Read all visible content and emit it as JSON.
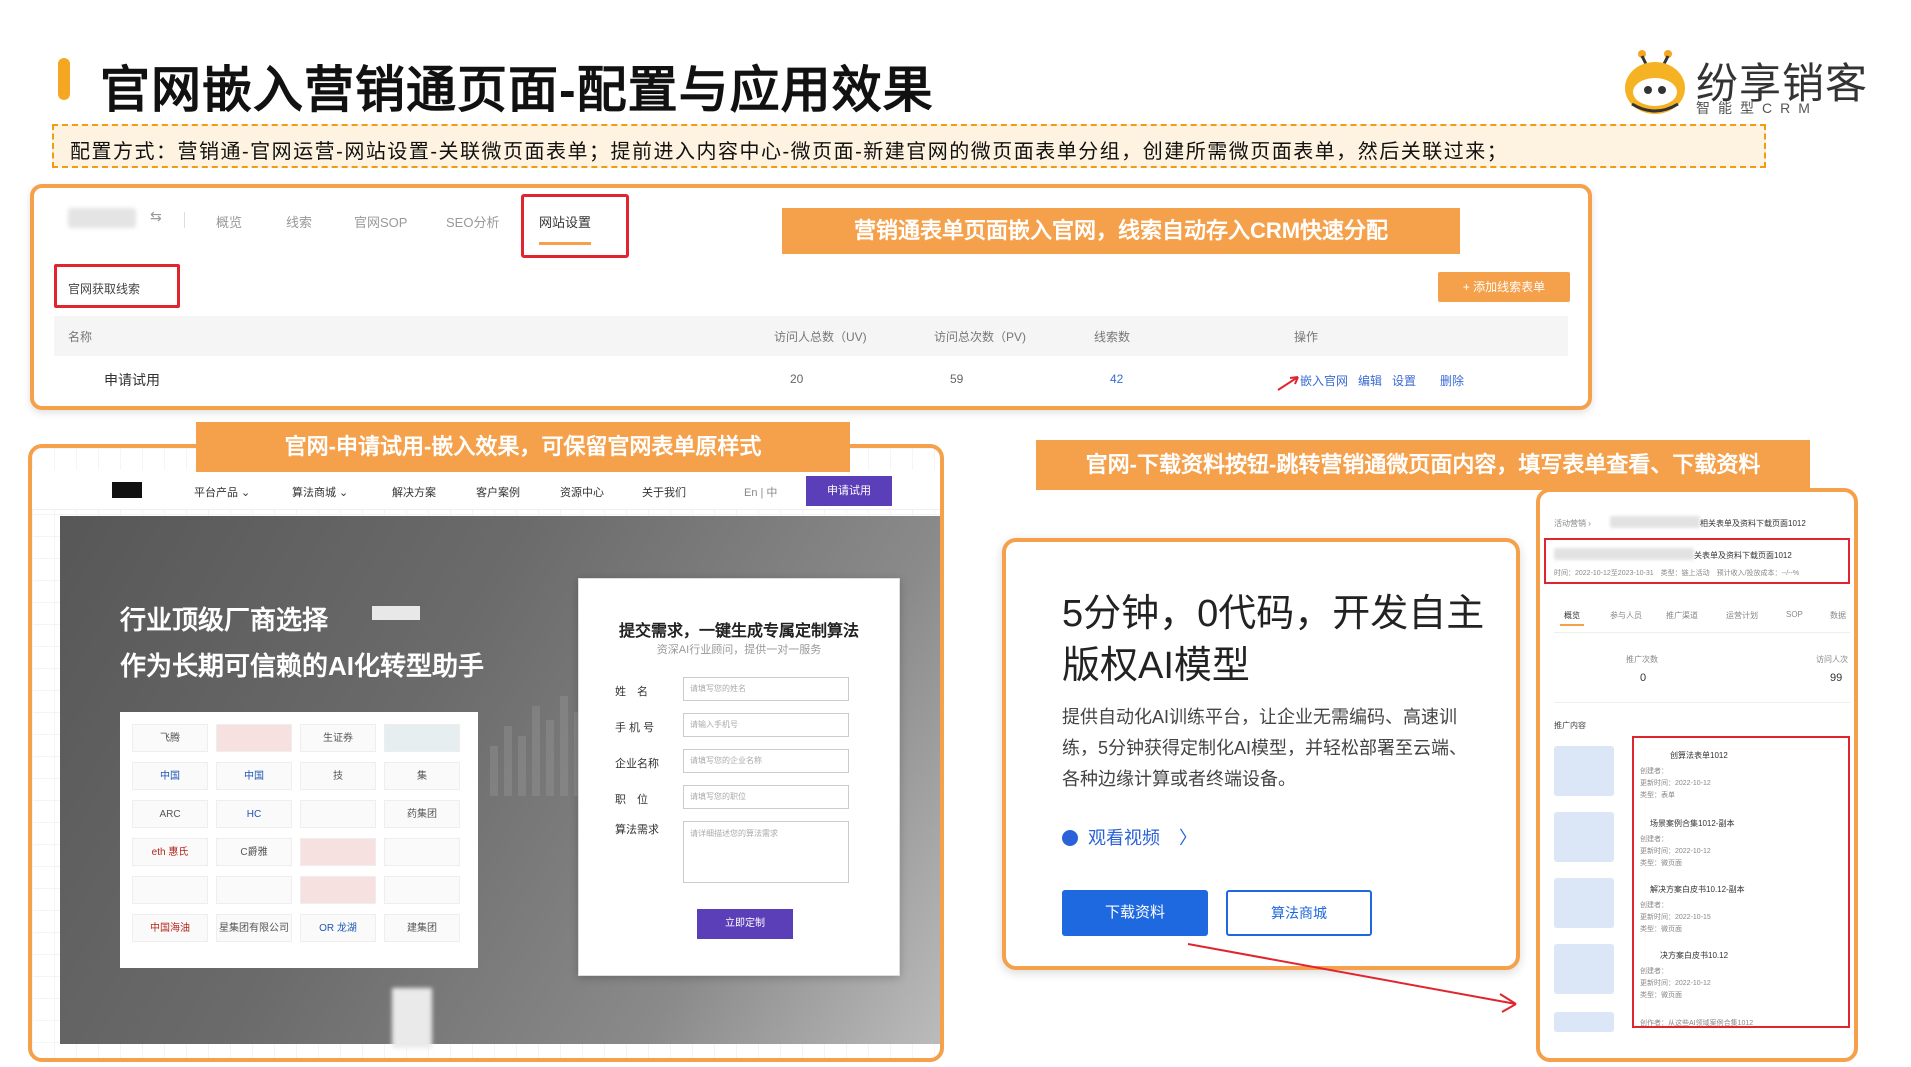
{
  "header": {
    "title": "官网嵌入营销通页面-配置与应用效果",
    "logo_text": "纷享销客",
    "logo_sub": "智能型CRM",
    "config_text": "配置方式：营销通-官网运营-网站设置-关联微页面表单；提前进入内容中心-微页面-新建官网的微页面表单分组，创建所需微页面表单，然后关联过来；"
  },
  "panel1": {
    "tabs": [
      "概览",
      "线索",
      "官网SOP",
      "SEO分析",
      "网站设置"
    ],
    "active_tab": "网站设置",
    "banner": "营销通表单页面嵌入官网，线索自动存入CRM快速分配",
    "section_label": "官网获取线索",
    "add_button": "+ 添加线索表单",
    "columns": [
      "名称",
      "访问人总数（UV)",
      "访问总次数（PV)",
      "线索数",
      "操作"
    ],
    "row": {
      "name": "申请试用",
      "uv": "20",
      "pv": "59",
      "leads": "42",
      "actions": [
        "嵌入官网",
        "编辑",
        "设置",
        "删除"
      ]
    }
  },
  "panel2": {
    "banner": "官网-申请试用-嵌入效果，可保留官网表单原样式",
    "nav": [
      "平台产品 ⌄",
      "算法商城 ⌄",
      "解决方案",
      "客户案例",
      "资源中心",
      "关于我们",
      "En | 中"
    ],
    "nav_button": "申请试用",
    "hero_line1": "行业顶级厂商选择",
    "hero_line2": "作为长期可信赖的AI化转型助手",
    "logos": [
      "飞腾",
      "",
      "生证券",
      "",
      "中国",
      "中国",
      "技",
      "集",
      "ARC",
      "HC",
      "",
      "药集团",
      "eth 惠氏",
      "C爵雅",
      "",
      "",
      "",
      "",
      "",
      "",
      "中国海油",
      "星集团有限公司",
      "OR 龙湖",
      "建集团"
    ],
    "form": {
      "title": "提交需求，一键生成专属定制算法",
      "subtitle": "资深AI行业顾问，提供一对一服务",
      "fields": [
        {
          "label": "姓　名",
          "placeholder": "请填写您的姓名"
        },
        {
          "label": "手 机 号",
          "placeholder": "请输入手机号"
        },
        {
          "label": "企业名称",
          "placeholder": "请填写您的企业名称"
        },
        {
          "label": "职　位",
          "placeholder": "请填写您的职位"
        }
      ],
      "textarea_label": "算法需求",
      "textarea_placeholder": "请详细描述您的算法需求",
      "submit": "立即定制"
    }
  },
  "panel3": {
    "banner": "官网-下载资料按钮-跳转营销通微页面内容，填写表单查看、下载资料",
    "title_line1": "5分钟，0代码，开发自主",
    "title_line2": "版权AI模型",
    "description": "提供自动化AI训练平台，让企业无需编码、高速训练，5分钟获得定制化AI模型，并轻松部署至云端、各种边缘计算或者终端设备。",
    "watch_video": "观看视频",
    "chevron": "〉",
    "btn_download": "下载资料",
    "btn_store": "算法商城"
  },
  "panel4": {
    "breadcrumb": "活动营销 ›",
    "page_title": "相关表单及资料下载页面1012",
    "row2": "关表单及资料下载页面1012",
    "meta": "时间：2022-10-12至2023-10-31　类型：链上活动　预计收入/投放成本：--/--%",
    "tabs": [
      "概览",
      "参与人员",
      "推广渠道",
      "运营计划",
      "SOP",
      "数据"
    ],
    "stat1_label": "推广次数",
    "stat1_value": "0",
    "stat2_label": "访问人次",
    "stat2_value": "99",
    "content_label": "推广内容",
    "items": [
      {
        "title": "创算法表单1012",
        "meta1": "创建者：",
        "meta2": "更新时间：2022-10-12",
        "meta3": "类型：表单"
      },
      {
        "title": "场景案例合集1012-副本",
        "meta1": "创建者：",
        "meta2": "更新时间：2022-10-12",
        "meta3": "类型：微页面"
      },
      {
        "title": "解决方案白皮书10.12-副本",
        "meta1": "创建者：",
        "meta2": "更新时间：2022-10-15",
        "meta3": "类型：微页面"
      },
      {
        "title": "决方案白皮书10.12",
        "meta1": "创建者：",
        "meta2": "更新时间：2022-10-12",
        "meta3": "类型：微页面"
      }
    ],
    "footer": "创作者：从这些AI领域案例合集1012"
  },
  "colors": {
    "accent": "#f5a04a",
    "highlight_red": "#e0252e",
    "link_blue": "#3a6ad4",
    "form_purple": "#5b3fb8",
    "button_blue": "#1e68e0"
  }
}
